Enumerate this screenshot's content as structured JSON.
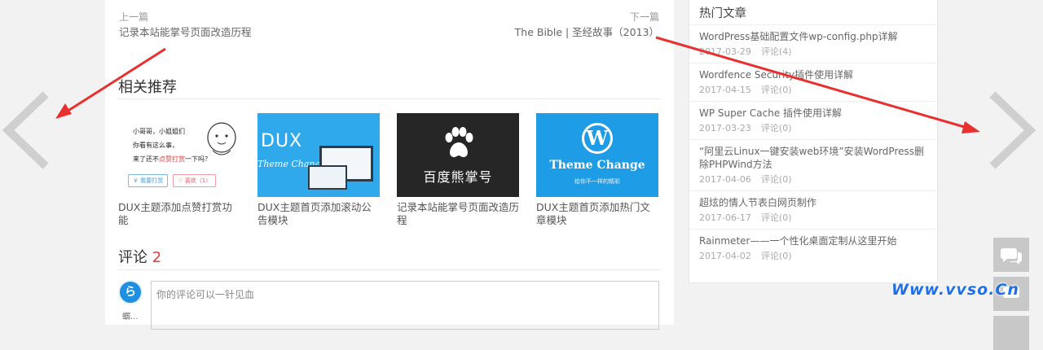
{
  "post_nav": {
    "prev_label": "上一篇",
    "prev_title": "记录本站能掌号页面改造历程",
    "next_label": "下一篇",
    "next_title": "The Bible | 圣经故事（2013）"
  },
  "related": {
    "title": "相关推荐",
    "items": [
      {
        "caption": "DUX主题添加点赞打赏功能",
        "thumb": {
          "line1": "小哥哥，小姐姐们",
          "line2": "你看有这么事，",
          "line3_a": "来了还不",
          "line3_red": "点赞打赏",
          "line3_b": "一下吗？",
          "btn1": "￥ 我要打赏",
          "btn2": "♡ 喜欢（1）"
        }
      },
      {
        "caption": "DUX主题首页添加滚动公告模块",
        "thumb": {
          "brand": "DUX",
          "tagline": "Theme Change"
        }
      },
      {
        "caption": "记录本站能掌号页面改造历程",
        "thumb": {
          "text": "百度熊掌号"
        }
      },
      {
        "caption": "DUX主题首页添加热门文章模块",
        "thumb": {
          "logo": "W",
          "brand": "Theme Change",
          "sub": "给你不一样的精彩"
        }
      }
    ]
  },
  "comments": {
    "title": "评论",
    "count": "2",
    "placeholder": "你的评论可以一针见血",
    "avatar_letter": "ら",
    "user_name": "蝈..."
  },
  "sidebar": {
    "title": "热门文章",
    "items": [
      {
        "title": "WordPress基础配置文件wp-config.php详解",
        "date": "2017-03-29",
        "comments": "评论(4)"
      },
      {
        "title": "Wordfence Security插件使用详解",
        "date": "2017-04-15",
        "comments": "评论(0)"
      },
      {
        "title": "WP Super Cache 插件使用详解",
        "date": "2017-03-23",
        "comments": "评论(0)"
      },
      {
        "title": "“阿里云Linux一键安装web环境”安装WordPress删除PHPWind方法",
        "date": "2017-04-06",
        "comments": "评论(0)"
      },
      {
        "title": "超炫的情人节表白网页制作",
        "date": "2017-06-17",
        "comments": "评论(0)"
      },
      {
        "title": "Rainmeter——一个性化桌面定制从这里开始",
        "date": "2017-04-02",
        "comments": "评论(0)"
      }
    ]
  },
  "watermark": "Www.vvso.Cn",
  "colors": {
    "accent_red": "#e4393c",
    "arrow_red": "#e8302f",
    "watermark_blue": "#1e6fe8"
  },
  "icons": {
    "left": "chevron-left-icon",
    "right": "chevron-right-icon",
    "float1": "chat-icon",
    "float2": "comment-icon"
  }
}
